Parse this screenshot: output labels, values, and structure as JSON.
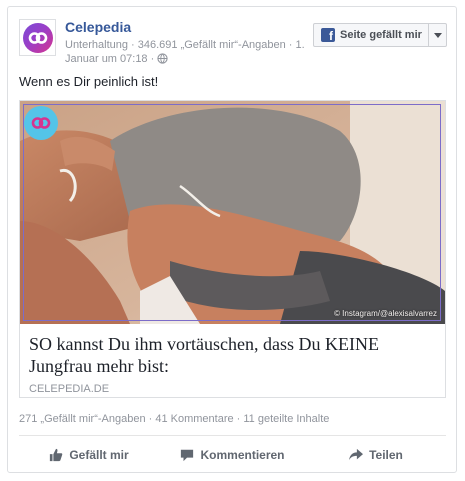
{
  "post": {
    "page_name": "Celepedia",
    "meta": "Unterhaltung · 346.691 „Gefällt mir“-Angaben · 1. Januar um 07:18 ·",
    "like_page_button": "Seite gefällt mir",
    "text": "Wenn es Dir peinlich ist!",
    "link": {
      "image_credit": "© Instagram/@alexisalvarrez",
      "title": "SO kannst Du ihm vortäuschen, dass Du KEINE Jungfrau mehr bist:",
      "domain": "CELEPEDIA.DE"
    },
    "stats": "271 „Gefällt mir“-Angaben · 41 Kommentare · 11 geteilte Inhalte",
    "actions": {
      "like": "Gefällt mir",
      "comment": "Kommentieren",
      "share": "Teilen"
    }
  },
  "icons": {
    "logo": "celepedia-logo-icon",
    "globe": "globe-icon",
    "facebook": "facebook-icon",
    "dropdown": "chevron-down-icon",
    "thumb": "thumbs-up-icon",
    "comment": "comment-bubble-icon",
    "share": "share-arrow-icon"
  },
  "colors": {
    "link_blue": "#365899",
    "badge_blue": "#54c4e8",
    "frame_purple": "#7c6cc9",
    "muted_text": "#90949c"
  }
}
